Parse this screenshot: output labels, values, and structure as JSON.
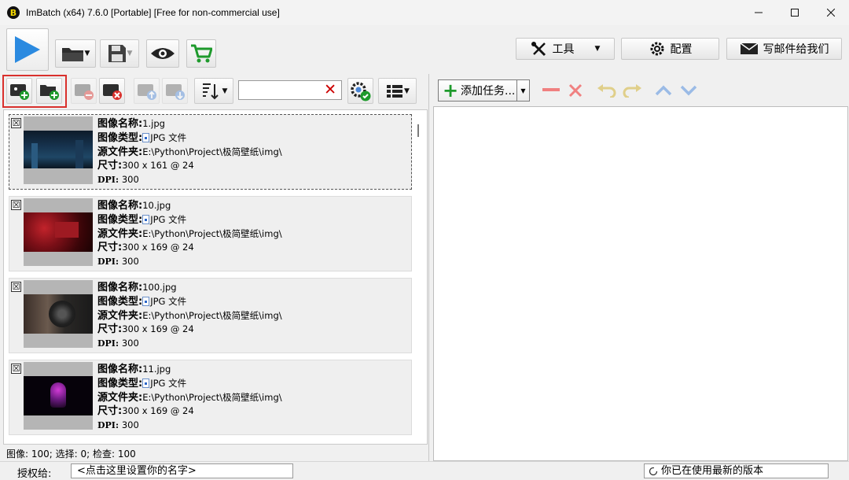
{
  "window": {
    "title": "ImBatch (x64) 7.6.0 [Portable] [Free for non-commercial use]",
    "icon_letter": "B"
  },
  "toolbar": {
    "tools_label": "工具",
    "config_label": "配置",
    "email_label": "写邮件给我们",
    "icons": [
      "play-icon",
      "open-folder-icon",
      "save-icon",
      "eye-icon",
      "cart-icon",
      "wrench-screwdriver-icon",
      "gear-icon",
      "envelope-icon"
    ]
  },
  "left_toolbar": {
    "filter_value": "",
    "clear_glyph": "✕"
  },
  "images": [
    {
      "name_label": "图像名称:",
      "name": "1.jpg",
      "type_label": "图像类型:",
      "type": "JPG 文件",
      "folder_label": "源文件夹:",
      "folder": "E:\\Python\\Project\\极简壁纸\\img\\",
      "size_label": "尺寸:",
      "size": "300 x 161 @ 24",
      "dpi_label": "DPI:",
      "dpi": "300",
      "checked_glyph": "☒"
    },
    {
      "name_label": "图像名称:",
      "name": "10.jpg",
      "type_label": "图像类型:",
      "type": "JPG 文件",
      "folder_label": "源文件夹:",
      "folder": "E:\\Python\\Project\\极简壁纸\\img\\",
      "size_label": "尺寸:",
      "size": "300 x 169 @ 24",
      "dpi_label": "DPI:",
      "dpi": "300",
      "checked_glyph": "☒"
    },
    {
      "name_label": "图像名称:",
      "name": "100.jpg",
      "type_label": "图像类型:",
      "type": "JPG 文件",
      "folder_label": "源文件夹:",
      "folder": "E:\\Python\\Project\\极简壁纸\\img\\",
      "size_label": "尺寸:",
      "size": "300 x 169 @ 24",
      "dpi_label": "DPI:",
      "dpi": "300",
      "checked_glyph": "☒"
    },
    {
      "name_label": "图像名称:",
      "name": "11.jpg",
      "type_label": "图像类型:",
      "type": "JPG 文件",
      "folder_label": "源文件夹:",
      "folder": "E:\\Python\\Project\\极简壁纸\\img\\",
      "size_label": "尺寸:",
      "size": "300 x 169 @ 24",
      "dpi_label": "DPI:",
      "dpi": "300",
      "checked_glyph": "☒"
    }
  ],
  "status": {
    "counts": "图像: 100; 选择: 0; 检查: 100"
  },
  "tasks": {
    "add_task_label": "添加任务..."
  },
  "footer": {
    "license_label": "授权给:",
    "license_placeholder": "<点击这里设置你的名字>",
    "version_text": "你已在使用最新的版本"
  },
  "colors": {
    "accent_blue": "#2b8ae0",
    "accent_green": "#1e9a2c",
    "danger_red": "#d9302c"
  }
}
